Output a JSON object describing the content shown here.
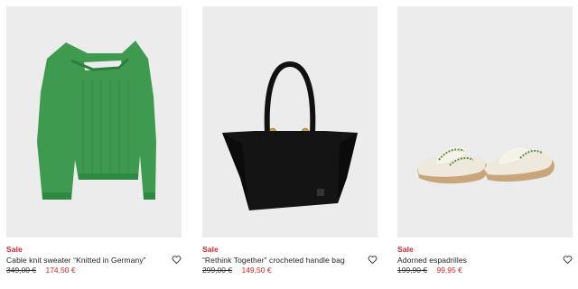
{
  "products": [
    {
      "badge": "Sale",
      "title": "Cable knit sweater “Knitted in Germany”",
      "old_price": "349,00 €",
      "new_price": "174,50 €",
      "image": "green-sweater",
      "icon": "heart-icon"
    },
    {
      "badge": "Sale",
      "title": "“Rethink Together” crocheted handle bag",
      "old_price": "299,00 €",
      "new_price": "149,50 €",
      "image": "black-handbag",
      "icon": "heart-icon"
    },
    {
      "badge": "Sale",
      "title": "Adorned espadrilles",
      "old_price": "199,90 €",
      "new_price": "99,95 €",
      "image": "espadrille-sandals",
      "icon": "heart-icon"
    }
  ],
  "colors": {
    "sale": "#d9222a",
    "image_bg": "#ececec",
    "text": "#222222"
  }
}
